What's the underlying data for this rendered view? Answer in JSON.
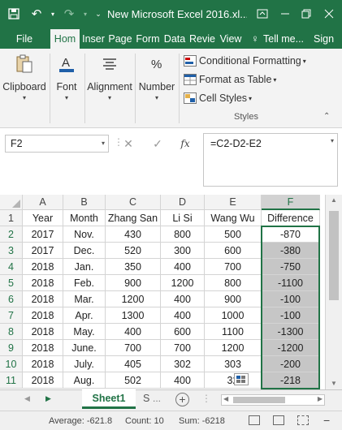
{
  "window": {
    "title": "New Microsoft Excel 2016.xl...",
    "accent": "#217346"
  },
  "tabs": [
    {
      "label": "File"
    },
    {
      "label": "Hom"
    },
    {
      "label": "Inser"
    },
    {
      "label": "Page"
    },
    {
      "label": "Form"
    },
    {
      "label": "Data"
    },
    {
      "label": "Revie"
    },
    {
      "label": "View"
    },
    {
      "label": "Tell me..."
    },
    {
      "label": "Sign"
    }
  ],
  "ribbon": {
    "clipboard": "Clipboard",
    "font": "Font",
    "alignment": "Alignment",
    "number": "Number",
    "conditional_formatting": "Conditional Formatting",
    "format_as_table": "Format as Table",
    "cell_styles": "Cell Styles",
    "styles_group": "Styles"
  },
  "formula_bar": {
    "name_box": "F2",
    "formula": "=C2-D2-E2",
    "fx": "fx"
  },
  "sheet": {
    "columns": [
      "A",
      "B",
      "C",
      "D",
      "E",
      "F"
    ],
    "header_row": [
      "Year",
      "Month",
      "Zhang San",
      "Li Si",
      "Wang Wu",
      "Difference"
    ],
    "rows": [
      [
        "2017",
        "Nov.",
        "430",
        "800",
        "500",
        "-870"
      ],
      [
        "2017",
        "Dec.",
        "520",
        "300",
        "600",
        "-380"
      ],
      [
        "2018",
        "Jan.",
        "350",
        "400",
        "700",
        "-750"
      ],
      [
        "2018",
        "Feb.",
        "900",
        "1200",
        "800",
        "-1100"
      ],
      [
        "2018",
        "Mar.",
        "1200",
        "400",
        "900",
        "-100"
      ],
      [
        "2018",
        "Apr.",
        "1300",
        "400",
        "1000",
        "-100"
      ],
      [
        "2018",
        "May.",
        "400",
        "600",
        "1100",
        "-1300"
      ],
      [
        "2018",
        "June.",
        "700",
        "700",
        "1200",
        "-1200"
      ],
      [
        "2018",
        "July.",
        "405",
        "302",
        "303",
        "-200"
      ],
      [
        "2018",
        "Aug.",
        "502",
        "400",
        "32",
        "-218"
      ]
    ],
    "row_numbers": [
      "1",
      "2",
      "3",
      "4",
      "5",
      "6",
      "7",
      "8",
      "9",
      "10",
      "11"
    ]
  },
  "sheet_tabs": {
    "active": "Sheet1",
    "next": "S"
  },
  "status": {
    "average": "Average: -621.8",
    "count": "Count: 10",
    "sum": "Sum: -6218"
  }
}
